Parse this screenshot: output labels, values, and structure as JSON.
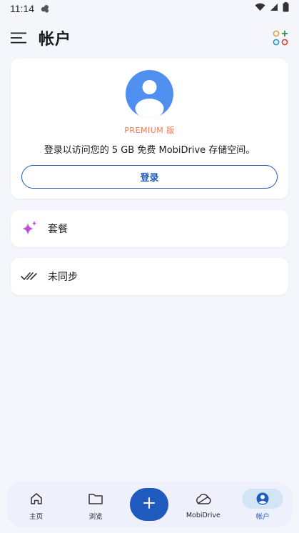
{
  "status_bar": {
    "time": "11:14"
  },
  "header": {
    "title": "帐户"
  },
  "account": {
    "premium_label": "PREMIUM 版",
    "description": "登录以访问您的 5 GB 免费 MobiDrive 存储空间。",
    "login_label": "登录"
  },
  "rows": {
    "plans_label": "套餐",
    "sync_label": "未同步"
  },
  "nav": {
    "home_label": "主页",
    "browse_label": "浏览",
    "drive_label": "MobiDrive",
    "account_label": "帐户"
  },
  "colors": {
    "accent": "#1f5bbf",
    "premium": "#f07a4f",
    "avatar": "#4f8ff0",
    "plans_icon": "#c246e0"
  },
  "icons": {
    "menu": "hamburger-menu-icon",
    "apps": "apps-add-icon",
    "avatar": "user-avatar-icon",
    "plans": "sparkle-icon",
    "sync": "double-check-icon",
    "home": "home-icon",
    "browse": "folder-icon",
    "add": "plus-icon",
    "drive": "cloud-icon",
    "account": "account-circle-icon"
  }
}
